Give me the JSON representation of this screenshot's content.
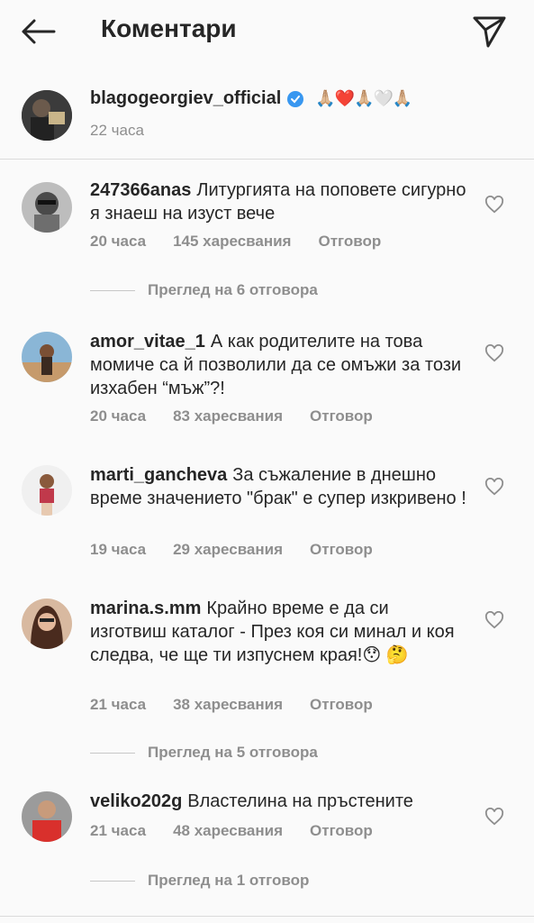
{
  "header": {
    "title": "Коментари",
    "back_icon": "arrow-left-icon",
    "send_icon": "paper-plane-icon"
  },
  "caption": {
    "username": "blagogeorgiev_official",
    "emojis": "🙏🏼❤️🙏🏼🤍🙏🏼",
    "time": "22 часа"
  },
  "comments": [
    {
      "username": "247366anas",
      "text": "Литургията на поповете сигурно я знаеш на изуст вече",
      "time": "20 часа",
      "likes": "145 харесвания",
      "reply": "Отговор",
      "view_replies": "Преглед на 6 отговора"
    },
    {
      "username": "amor_vitae_1",
      "text": "А как родителите на това момиче са й позволили да се омъжи за този изхабен “мъж”?!",
      "time": "20 часа",
      "likes": "83 харесвания",
      "reply": "Отговор"
    },
    {
      "username": "marti_gancheva",
      "text": "За съжаление в днешно време значението \"брак\" е супер изкривено !",
      "time": "19 часа",
      "likes": "29 харесвания",
      "reply": "Отговор"
    },
    {
      "username": "marina.s.mm",
      "text": "Крайно време е да си изготвиш каталог - През коя си минал и коя следва, че ще ти изпуснем края!😯 🤔",
      "time": "21 часа",
      "likes": "38 харесвания",
      "reply": "Отговор",
      "view_replies": "Преглед на 5 отговора"
    },
    {
      "username": "veliko202g",
      "text": "Властелина на пръстените",
      "time": "21 часа",
      "likes": "48 харесвания",
      "reply": "Отговор",
      "view_replies": "Преглед на 1 отговор"
    }
  ],
  "colors": {
    "text": "#262626",
    "secondary": "#8e8e8e",
    "verified": "#3897f0",
    "background": "#fafafa"
  }
}
